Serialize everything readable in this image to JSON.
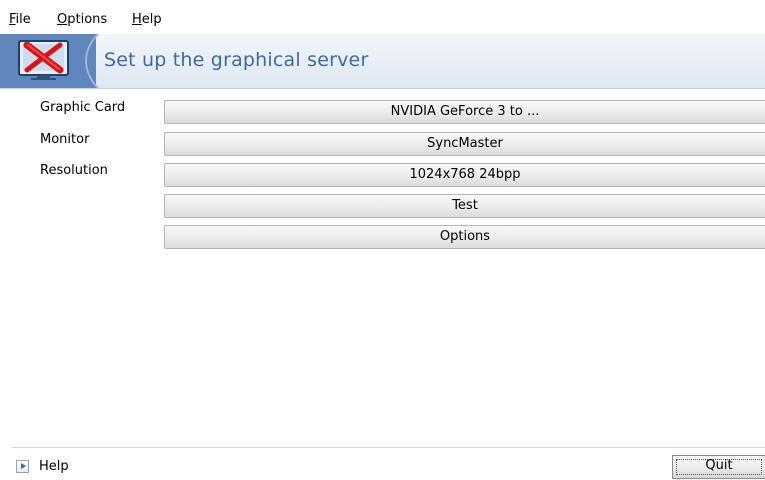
{
  "menubar": {
    "items": [
      {
        "label": "File",
        "mnemonic": "F",
        "rest": "ile"
      },
      {
        "label": "Options",
        "mnemonic": "O",
        "rest": "ptions"
      },
      {
        "label": "Help",
        "mnemonic": "H",
        "rest": "elp"
      }
    ]
  },
  "banner": {
    "title": "Set up the graphical server",
    "logo_icon": "xfdrake-x-monitor-icon",
    "accent_color": "#5f86bd",
    "title_color": "#3d6aa4"
  },
  "settings": {
    "graphic_card": {
      "label": "Graphic Card",
      "value": "NVIDIA GeForce 3 to ..."
    },
    "monitor": {
      "label": "Monitor",
      "value": "SyncMaster"
    },
    "resolution": {
      "label": "Resolution",
      "value": "1024x768 24bpp"
    }
  },
  "actions": {
    "test_label": "Test",
    "options_label": "Options"
  },
  "footer": {
    "help_label": "Help",
    "help_icon": "expander-arrow-icon",
    "quit_label": "Quit"
  }
}
